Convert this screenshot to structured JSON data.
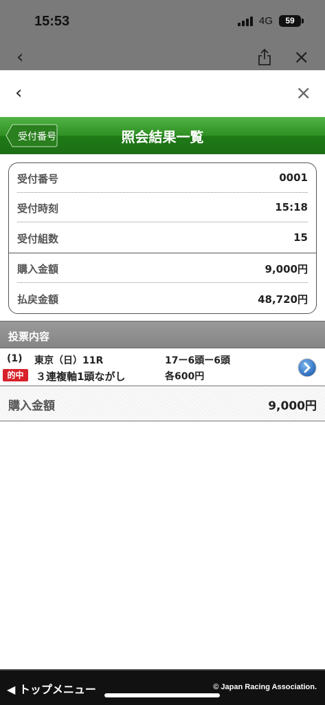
{
  "status_bar": {
    "time": "15:53",
    "network": "4G",
    "battery": "59"
  },
  "browser": {
    "back_icon": "chevron-left-icon",
    "share_icon": "share-icon",
    "close_icon": "close-icon"
  },
  "sheet": {
    "back_icon": "chevron-left-icon",
    "close_icon": "close-icon"
  },
  "header": {
    "back_label": "受付番号",
    "title": "照会結果一覧",
    "color": "#2f8f24"
  },
  "receipt": {
    "rows": [
      {
        "label": "受付番号",
        "value": "0001"
      },
      {
        "label": "受付時刻",
        "value": "15:18"
      },
      {
        "label": "受付組数",
        "value": "15"
      },
      {
        "label": "購入金額",
        "value": "9,000円"
      },
      {
        "label": "払戻金額",
        "value": "48,720円"
      }
    ]
  },
  "bets_section": {
    "title": "投票内容"
  },
  "bet": {
    "number": "(1)",
    "race": "東京（日）11R",
    "combination": "17ー6頭ー6頭",
    "hit_label": "的中",
    "hit_color": "#d8212a",
    "type": "３連複軸1頭ながし",
    "each_amount": "各600円"
  },
  "total": {
    "label": "購入金額",
    "value": "9,000円"
  },
  "footer": {
    "menu_label": "トップメニュー",
    "copyright": "© Japan Racing Association."
  }
}
